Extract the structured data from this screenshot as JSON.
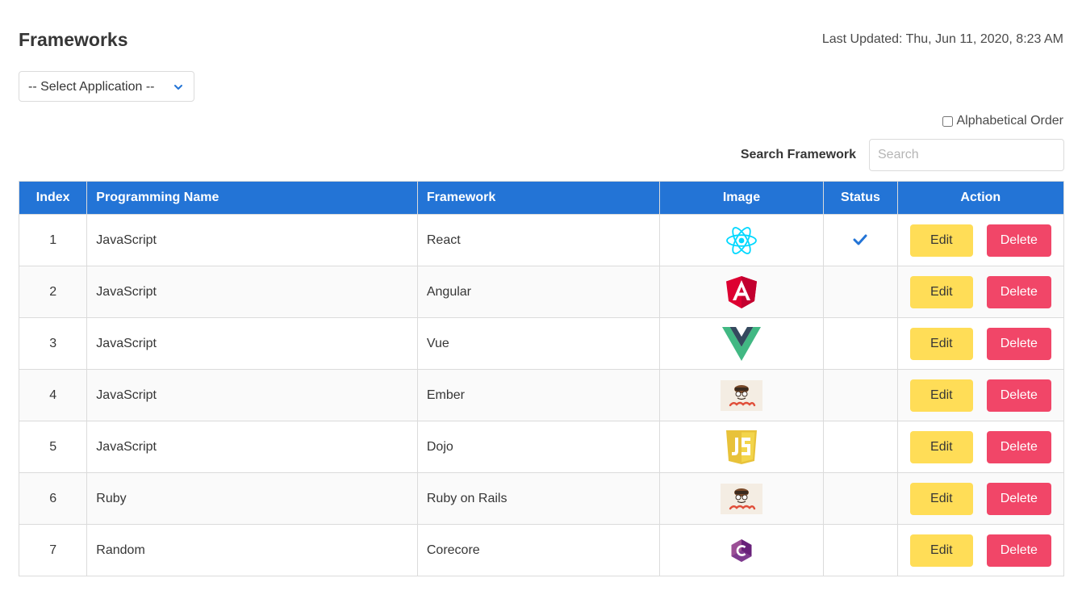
{
  "header": {
    "title": "Frameworks",
    "last_updated": "Last Updated: Thu, Jun 11, 2020, 8:23 AM"
  },
  "app_select": {
    "selected": "-- Select Application --",
    "chevron_icon": "chevron-down-icon"
  },
  "alphabetical": {
    "label": "Alphabetical Order",
    "checked": false
  },
  "search": {
    "label": "Search Framework",
    "placeholder": "Search",
    "value": ""
  },
  "table": {
    "columns": [
      "Index",
      "Programming Name",
      "Framework",
      "Image",
      "Status",
      "Action"
    ],
    "edit_label": "Edit",
    "delete_label": "Delete",
    "rows": [
      {
        "index": "1",
        "language": "JavaScript",
        "framework": "React",
        "logo": "react-logo",
        "status": true
      },
      {
        "index": "2",
        "language": "JavaScript",
        "framework": "Angular",
        "logo": "angular-logo",
        "status": false
      },
      {
        "index": "3",
        "language": "JavaScript",
        "framework": "Vue",
        "logo": "vue-logo",
        "status": false
      },
      {
        "index": "4",
        "language": "JavaScript",
        "framework": "Ember",
        "logo": "ember-logo",
        "status": false
      },
      {
        "index": "5",
        "language": "JavaScript",
        "framework": "Dojo",
        "logo": "js-logo",
        "status": false
      },
      {
        "index": "6",
        "language": "Ruby",
        "framework": "Ruby on Rails",
        "logo": "ember-logo",
        "status": false
      },
      {
        "index": "7",
        "language": "Random",
        "framework": "Corecore",
        "logo": "csharp-logo",
        "status": false
      }
    ]
  },
  "colors": {
    "header_bg": "#2374d6",
    "edit_bg": "#ffdd57",
    "delete_bg": "#f14668",
    "check": "#2374d6"
  }
}
